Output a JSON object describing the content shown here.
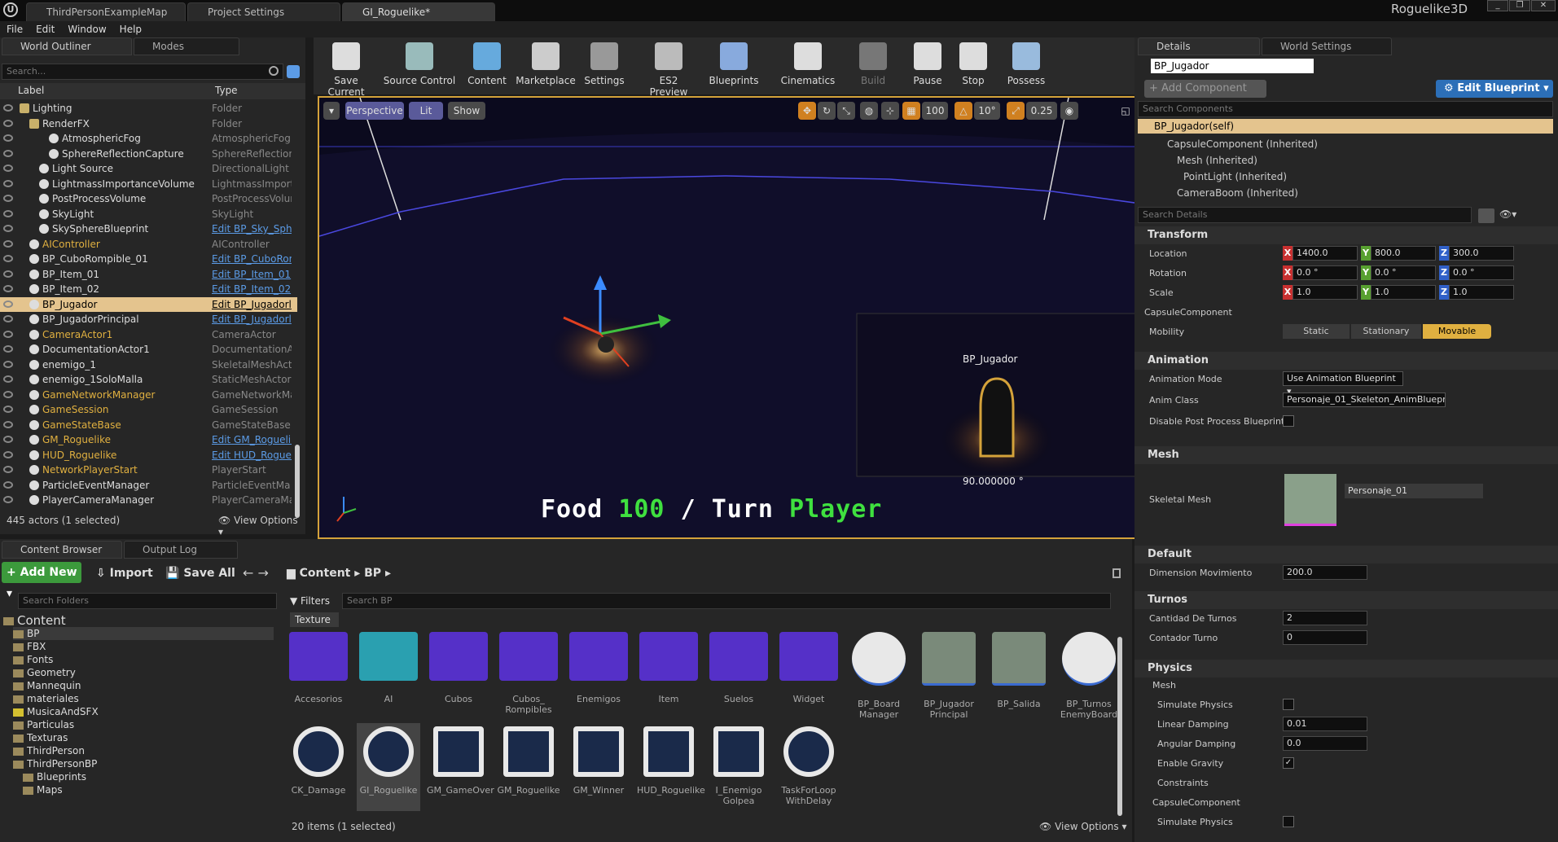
{
  "doc_tabs": [
    "ThirdPersonExampleMap",
    "Project Settings",
    "GI_Roguelike*"
  ],
  "project_name": "Roguelike3D",
  "menu": [
    "File",
    "Edit",
    "Window",
    "Help"
  ],
  "outliner": {
    "tabs": [
      "World Outliner",
      "Modes"
    ],
    "search_placeholder": "Search...",
    "col_label": "Label",
    "col_type": "Type",
    "rows": [
      {
        "label": "Lighting",
        "type": "Folder",
        "link": false
      },
      {
        "label": "RenderFX",
        "type": "Folder",
        "link": false
      },
      {
        "label": "AtmosphericFog",
        "type": "AtmosphericFog",
        "link": false
      },
      {
        "label": "SphereReflectionCapture",
        "type": "SphereReflectionC",
        "link": false
      },
      {
        "label": "Light Source",
        "type": "DirectionalLight",
        "link": false
      },
      {
        "label": "LightmassImportanceVolume",
        "type": "LightmassImporta",
        "link": false
      },
      {
        "label": "PostProcessVolume",
        "type": "PostProcessVolur",
        "link": false
      },
      {
        "label": "SkyLight",
        "type": "SkyLight",
        "link": false
      },
      {
        "label": "SkySphereBlueprint",
        "type": "Edit BP_Sky_Sph",
        "link": true
      },
      {
        "label": "AIController",
        "type": "AIController",
        "link": false
      },
      {
        "label": "BP_CuboRompible_01",
        "type": "Edit BP_CuboRor",
        "link": true
      },
      {
        "label": "BP_Item_01",
        "type": "Edit BP_Item_01",
        "link": true
      },
      {
        "label": "BP_Item_02",
        "type": "Edit BP_Item_02",
        "link": true
      },
      {
        "label": "BP_Jugador",
        "type": "Edit BP_Jugadorl",
        "link": true
      },
      {
        "label": "BP_JugadorPrincipal",
        "type": "Edit BP_Jugadorl",
        "link": true
      },
      {
        "label": "CameraActor1",
        "type": "CameraActor",
        "link": false
      },
      {
        "label": "DocumentationActor1",
        "type": "DocumentationAc",
        "link": false
      },
      {
        "label": "enemigo_1",
        "type": "SkeletalMeshActo",
        "link": false
      },
      {
        "label": "enemigo_1SoloMalla",
        "type": "StaticMeshActor",
        "link": false
      },
      {
        "label": "GameNetworkManager",
        "type": "GameNetworkMan",
        "link": false
      },
      {
        "label": "GameSession",
        "type": "GameSession",
        "link": false
      },
      {
        "label": "GameStateBase",
        "type": "GameStateBase",
        "link": false
      },
      {
        "label": "GM_Roguelike",
        "type": "Edit GM_Roguelil",
        "link": true
      },
      {
        "label": "HUD_Roguelike",
        "type": "Edit HUD_Roguel",
        "link": true
      },
      {
        "label": "NetworkPlayerStart",
        "type": "PlayerStart",
        "link": false
      },
      {
        "label": "ParticleEventManager",
        "type": "ParticleEventMa",
        "link": false
      },
      {
        "label": "PlayerCameraManager",
        "type": "PlayerCameraMar",
        "link": false
      }
    ],
    "status": "445 actors (1 selected)",
    "view_options": "View Options"
  },
  "toolbar": [
    "Save Current",
    "Source Control",
    "Content",
    "Marketplace",
    "Settings",
    "ES2 Preview",
    "Blueprints",
    "Cinematics",
    "Build",
    "Pause",
    "Stop",
    "Possess"
  ],
  "viewport": {
    "perspective": "Perspective",
    "lit": "Lit",
    "show": "Show",
    "grid": "100",
    "angle": "10°",
    "scale": "0.25",
    "actor_label": "BP_Jugador",
    "rotation": "90.000000 °",
    "hud_food": "Food",
    "hud_food_val": "100",
    "hud_sep": "/",
    "hud_turn": "Turn",
    "hud_turn_val": "Player"
  },
  "details": {
    "tabs": [
      "Details",
      "World Settings"
    ],
    "name": "BP_Jugador",
    "add_component": "+ Add Component",
    "edit_blueprint": "Edit Blueprint",
    "search_components": "Search Components",
    "self": "BP_Jugador(self)",
    "components": [
      "CapsuleComponent (Inherited)",
      "Mesh (Inherited)",
      "PointLight (Inherited)",
      "CameraBoom (Inherited)"
    ],
    "search_details": "Search Details",
    "transform": "Transform",
    "location": "Location",
    "rotation": "Rotation",
    "scale": "Scale",
    "loc": [
      "1400.0",
      "800.0",
      "300.0"
    ],
    "rot": [
      "0.0 °",
      "0.0 °",
      "0.0 °"
    ],
    "scl": [
      "1.0",
      "1.0",
      "1.0"
    ],
    "capsule": "CapsuleComponent",
    "mobility": "Mobility",
    "mob_opts": [
      "Static",
      "Stationary",
      "Movable"
    ],
    "animation": "Animation",
    "anim_mode": "Animation Mode",
    "anim_mode_val": "Use Animation Blueprint",
    "anim_class": "Anim Class",
    "anim_class_val": "Personaje_01_Skeleton_AnimBlueprir",
    "disable_pp": "Disable Post Process Blueprint",
    "mesh": "Mesh",
    "skeletal_mesh": "Skeletal Mesh",
    "skeletal_mesh_val": "Personaje_01",
    "default": "Default",
    "dim_mov": "Dimension Movimiento",
    "dim_mov_val": "200.0",
    "turnos": "Turnos",
    "cant_turnos": "Cantidad De Turnos",
    "cant_turnos_val": "2",
    "contador": "Contador Turno",
    "contador_val": "0",
    "physics": "Physics",
    "phys_mesh": "Mesh",
    "sim_phys": "Simulate Physics",
    "lin_damp": "Linear Damping",
    "lin_damp_val": "0.01",
    "ang_damp": "Angular Damping",
    "ang_damp_val": "0.0",
    "enable_grav": "Enable Gravity",
    "constraints": "Constraints",
    "capsule2": "CapsuleComponent",
    "sim_phys2": "Simulate Physics"
  },
  "content_browser": {
    "tabs": [
      "Content Browser",
      "Output Log"
    ],
    "add_new": "Add New",
    "import": "Import",
    "save_all": "Save All",
    "path": [
      "Content",
      "BP"
    ],
    "search_folders": "Search Folders",
    "filters": "Filters",
    "search_bp": "Search BP",
    "texture_chip": "Texture",
    "tree": [
      {
        "name": "Content",
        "level": 0
      },
      {
        "name": "BP",
        "level": 1
      },
      {
        "name": "FBX",
        "level": 1
      },
      {
        "name": "Fonts",
        "level": 1
      },
      {
        "name": "Geometry",
        "level": 1
      },
      {
        "name": "Mannequin",
        "level": 1
      },
      {
        "name": "materiales",
        "level": 1
      },
      {
        "name": "MusicaAndSFX",
        "level": 1
      },
      {
        "name": "Particulas",
        "level": 1
      },
      {
        "name": "Texturas",
        "level": 1
      },
      {
        "name": "ThirdPerson",
        "level": 1
      },
      {
        "name": "ThirdPersonBP",
        "level": 1
      },
      {
        "name": "Blueprints",
        "level": 2
      },
      {
        "name": "Maps",
        "level": 2
      }
    ],
    "assets_row1": [
      "Accesorios",
      "AI",
      "Cubos",
      "Cubos_ Rompibles",
      "Enemigos",
      "Item",
      "Suelos",
      "Widget",
      "BP_Board Manager",
      "BP_Jugador Principal",
      "BP_Salida",
      "BP_Turnos EnemyBoard"
    ],
    "assets_row2": [
      "CK_Damage",
      "GI_Roguelike",
      "GM_GameOver",
      "GM_Roguelike",
      "GM_Winner",
      "HUD_Roguelike",
      "I_Enemigo Golpea",
      "TaskForLoop WithDelay"
    ],
    "status": "20 items (1 selected)",
    "view_options": "View Options"
  }
}
